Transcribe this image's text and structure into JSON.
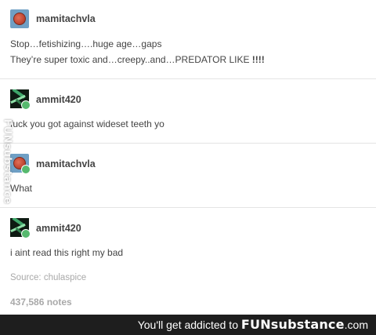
{
  "posts": [
    {
      "username": "mamitachvla",
      "lines": [
        "Stop…fetishizing….huge age…gaps",
        "They’re super toxic and…creepy..and…PREDATOR LIKE "
      ],
      "emphasis": "!!!!"
    },
    {
      "username": "ammit420",
      "lines": [
        "fuck you got against wideset teeth yo"
      ]
    },
    {
      "username": "mamitachvla",
      "lines": [
        "What"
      ]
    },
    {
      "username": "ammit420",
      "lines": [
        "i aint read this right my bad"
      ]
    }
  ],
  "source": "Source: chulaspice",
  "notes": "437,586 notes",
  "watermark": {
    "side": "FUNsubstance",
    "footer_prefix": "You'll get addicted to ",
    "footer_brand": "FUNsubstance",
    "footer_domain": ".com"
  },
  "colors": {
    "text": "#444444",
    "muted": "#a9a9a9",
    "footer_bg": "#1e1e1e",
    "badge_green": "#56b96e"
  }
}
